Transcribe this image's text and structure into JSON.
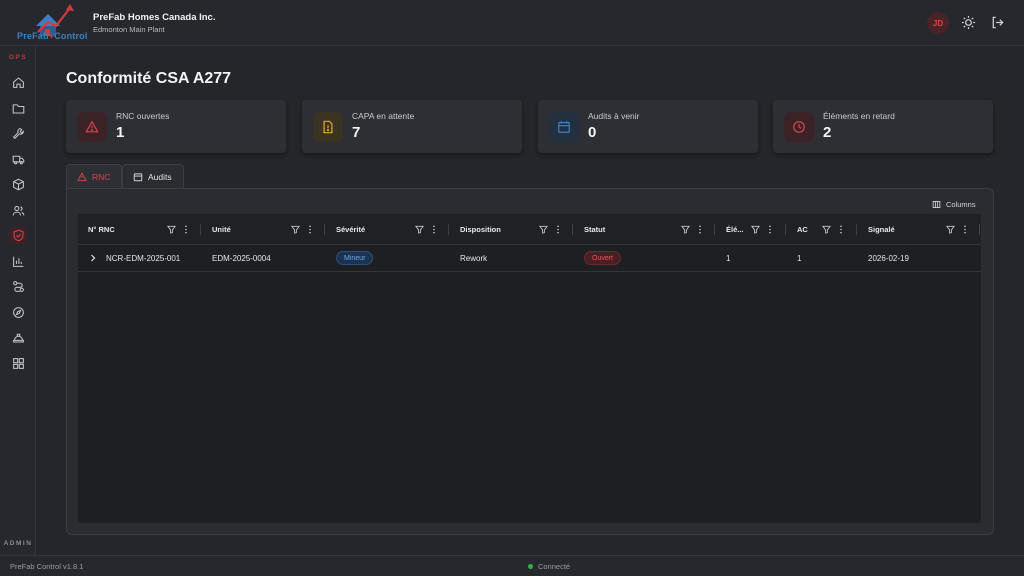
{
  "app": {
    "logo_text_prefix": "PreFab",
    "logo_text_suffix": "Control",
    "org_title": "PreFab Homes Canada Inc.",
    "org_subtitle": "Edmonton Main Plant",
    "user_initials": "JD"
  },
  "sidebar": {
    "section_top": "OPS",
    "section_bottom": "ADMIN",
    "items": [
      {
        "icon": "home-icon"
      },
      {
        "icon": "folder-icon"
      },
      {
        "icon": "wrench-icon"
      },
      {
        "icon": "truck-icon"
      },
      {
        "icon": "box-icon"
      },
      {
        "icon": "users-icon"
      },
      {
        "icon": "shield-icon",
        "active": true
      },
      {
        "icon": "bar-chart-icon"
      },
      {
        "icon": "route-icon"
      },
      {
        "icon": "compass-icon"
      },
      {
        "icon": "hard-hat-icon"
      },
      {
        "icon": "grid-icon"
      }
    ]
  },
  "page": {
    "title": "Conformité CSA A277"
  },
  "stats": [
    {
      "label": "RNC ouvertes",
      "value": "1",
      "icon": "warning-icon",
      "color": "#d6454b",
      "bg": "#3a2227"
    },
    {
      "label": "CAPA en attente",
      "value": "7",
      "icon": "file-alert-icon",
      "color": "#e0a82e",
      "bg": "#3b3322"
    },
    {
      "label": "Audits à venir",
      "value": "0",
      "icon": "calendar-icon",
      "color": "#3b82c4",
      "bg": "#22303f"
    },
    {
      "label": "Éléments en retard",
      "value": "2",
      "icon": "clock-icon",
      "color": "#d6454b",
      "bg": "#3a2227"
    }
  ],
  "tabs": [
    {
      "label": "RNC",
      "active": true
    },
    {
      "label": "Audits",
      "active": false
    }
  ],
  "grid": {
    "columns_button": "Columns",
    "headers": [
      "N° RNC",
      "Unité",
      "Sévérité",
      "Disposition",
      "Statut",
      "Élé...",
      "AC",
      "Signalé"
    ],
    "rows": [
      {
        "ncr": "NCR-EDM-2025-001",
        "unit": "EDM-2025-0004",
        "severity": "Mineur",
        "disposition": "Rework",
        "status": "Ouvert",
        "elements": "1",
        "ac": "1",
        "reported": "2026-02-19"
      }
    ]
  },
  "footer": {
    "version": "PreFab Control v1.8.1",
    "status": "Connecté"
  },
  "colors": {
    "accent_red": "#d6454b",
    "accent_blue": "#3b82c4",
    "status_green": "#2fb24a"
  }
}
